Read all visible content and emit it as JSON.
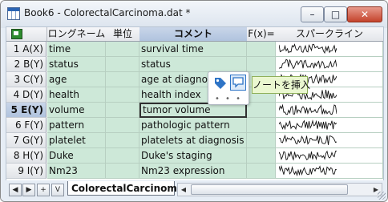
{
  "window": {
    "title": "Book6 - ColorectalCarcinoma.dat *",
    "buttons": {
      "minimize": "–",
      "maximize": "□",
      "close": "✕"
    }
  },
  "columns": {
    "long_name": "ロングネーム",
    "units": "単位",
    "comments": "コメント",
    "fx": "F(x)=",
    "sparklines": "スパークライン"
  },
  "rows": [
    {
      "header": "1 A(X)",
      "long_name": "time",
      "units": "",
      "comment": "survival time"
    },
    {
      "header": "2 B(Y)",
      "long_name": "status",
      "units": "",
      "comment": "status"
    },
    {
      "header": "3 C(Y)",
      "long_name": "age",
      "units": "",
      "comment": "age at diagnosis"
    },
    {
      "header": "4 D(Y)",
      "long_name": "health",
      "units": "",
      "comment": "health index"
    },
    {
      "header": "5 E(Y)",
      "long_name": "volume",
      "units": "",
      "comment": "tumor volume"
    },
    {
      "header": "6 F(Y)",
      "long_name": "pattern",
      "units": "",
      "comment": "pathologic pattern"
    },
    {
      "header": "7 G(Y)",
      "long_name": "platelet",
      "units": "",
      "comment": "platelets at diagnosis"
    },
    {
      "header": "8 H(Y)",
      "long_name": "Duke",
      "units": "",
      "comment": "Duke's staging"
    },
    {
      "header": "9 I(Y)",
      "long_name": "Nm23",
      "units": "",
      "comment": "Nm23 expression"
    }
  ],
  "sheet_tab": {
    "label": "ColorectalCarcinoma"
  },
  "nav": {
    "prev": "◀",
    "next": "▶",
    "add": "+",
    "menu": "V"
  },
  "mini_toolbar": {
    "tooltip": "ノートを挿入",
    "more": "• • •"
  },
  "scrollbar": {
    "left": "◀",
    "right": "▶"
  },
  "colors": {
    "data_cell": "#cde8d8",
    "header_selected": "#b0c3de",
    "close_button": "#c4432c",
    "tooltip_bg": "#eaf7d0"
  },
  "icons": {
    "corner": "worksheet-select-all-icon",
    "tag": "tag-icon",
    "note": "insert-note-icon",
    "grip": "resize-grip-icon"
  }
}
